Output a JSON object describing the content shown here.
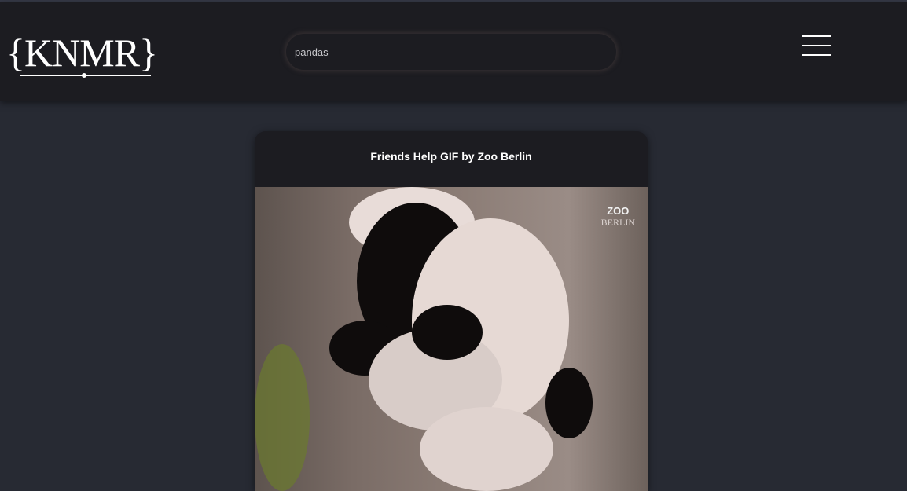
{
  "header": {
    "logo_text": "{KNMR}",
    "search_value": "pandas"
  },
  "card": {
    "title": "Friends Help GIF by Zoo Berlin",
    "watermark_top": "ZOO",
    "watermark_bottom": "BERLIN"
  }
}
